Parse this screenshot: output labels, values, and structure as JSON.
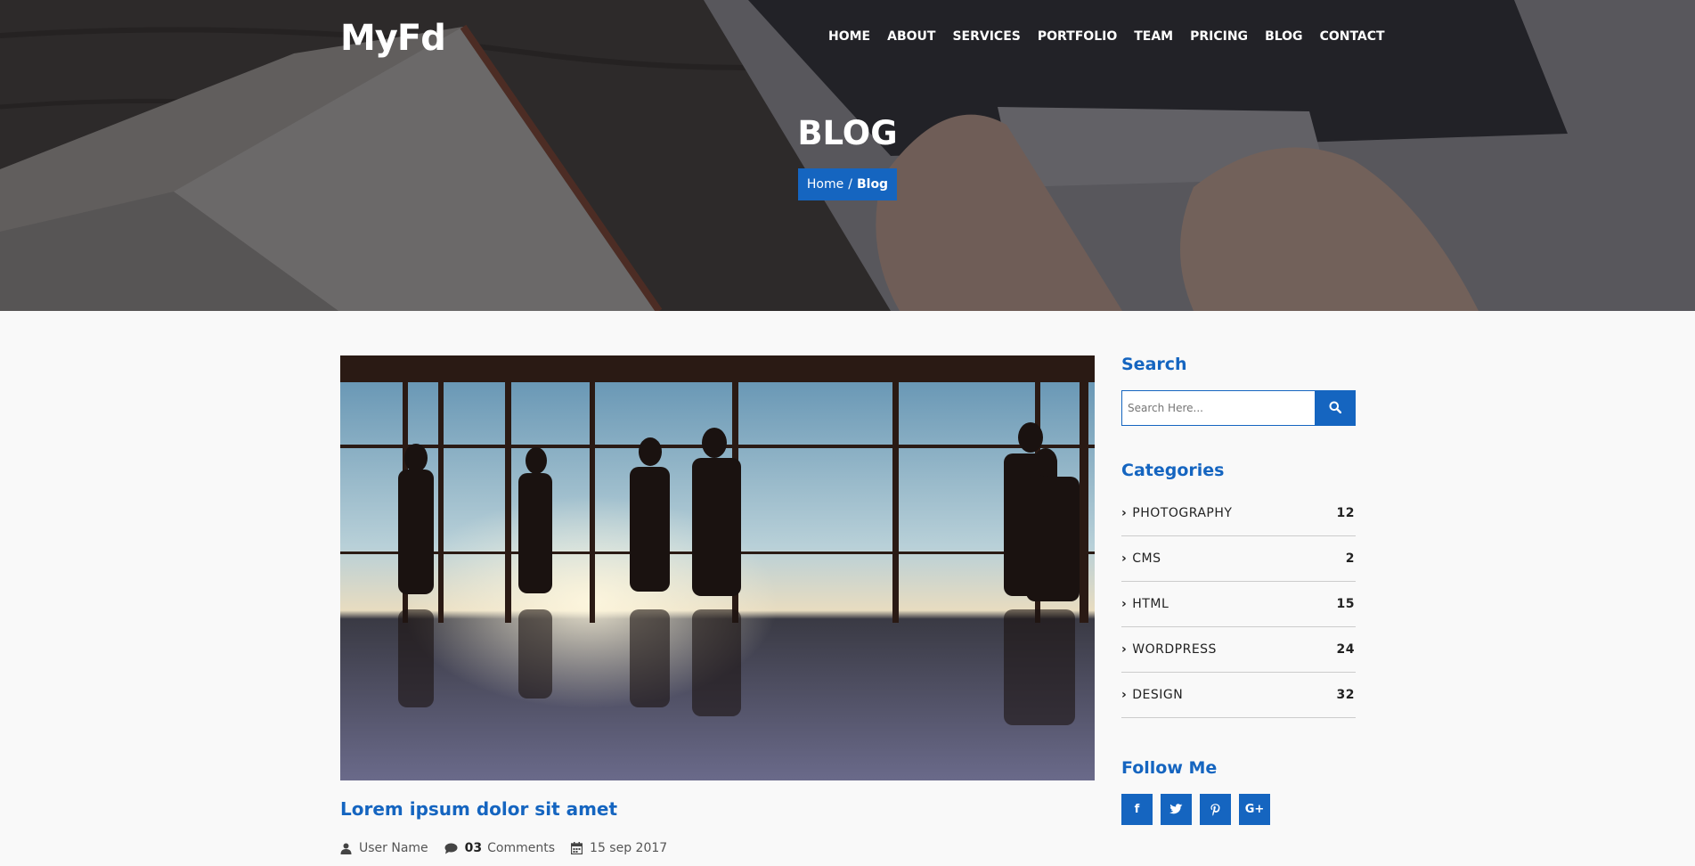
{
  "site": {
    "logo": "MyFd"
  },
  "nav": {
    "items": [
      {
        "label": "HOME"
      },
      {
        "label": "ABOUT"
      },
      {
        "label": "SERVICES"
      },
      {
        "label": "PORTFOLIO"
      },
      {
        "label": "TEAM"
      },
      {
        "label": "PRICING"
      },
      {
        "label": "BLOG"
      },
      {
        "label": "CONTACT"
      }
    ]
  },
  "hero": {
    "title": "BLOG",
    "breadcrumb": {
      "home": "Home",
      "separator": "/",
      "current": "Blog"
    }
  },
  "post": {
    "title": "Lorem ipsum dolor sit amet",
    "author": "User Name",
    "comments_count": "03",
    "comments_label": "Comments",
    "date": "15 sep 2017"
  },
  "sidebar": {
    "search": {
      "heading": "Search",
      "placeholder": "Search Here..."
    },
    "categories": {
      "heading": "Categories",
      "items": [
        {
          "label": "PHOTOGRAPHY",
          "count": "12"
        },
        {
          "label": "CMS",
          "count": "2"
        },
        {
          "label": "HTML",
          "count": "15"
        },
        {
          "label": "WORDPRESS",
          "count": "24"
        },
        {
          "label": "DESIGN",
          "count": "32"
        }
      ]
    },
    "follow": {
      "heading": "Follow Me",
      "networks": [
        {
          "icon": "facebook-icon",
          "glyph": "f"
        },
        {
          "icon": "twitter-icon",
          "glyph": "t"
        },
        {
          "icon": "pinterest-icon",
          "glyph": "P"
        },
        {
          "icon": "google-plus-icon",
          "glyph": "G+"
        }
      ]
    }
  },
  "colors": {
    "accent": "#1565c0",
    "background": "#f9f9f9"
  }
}
